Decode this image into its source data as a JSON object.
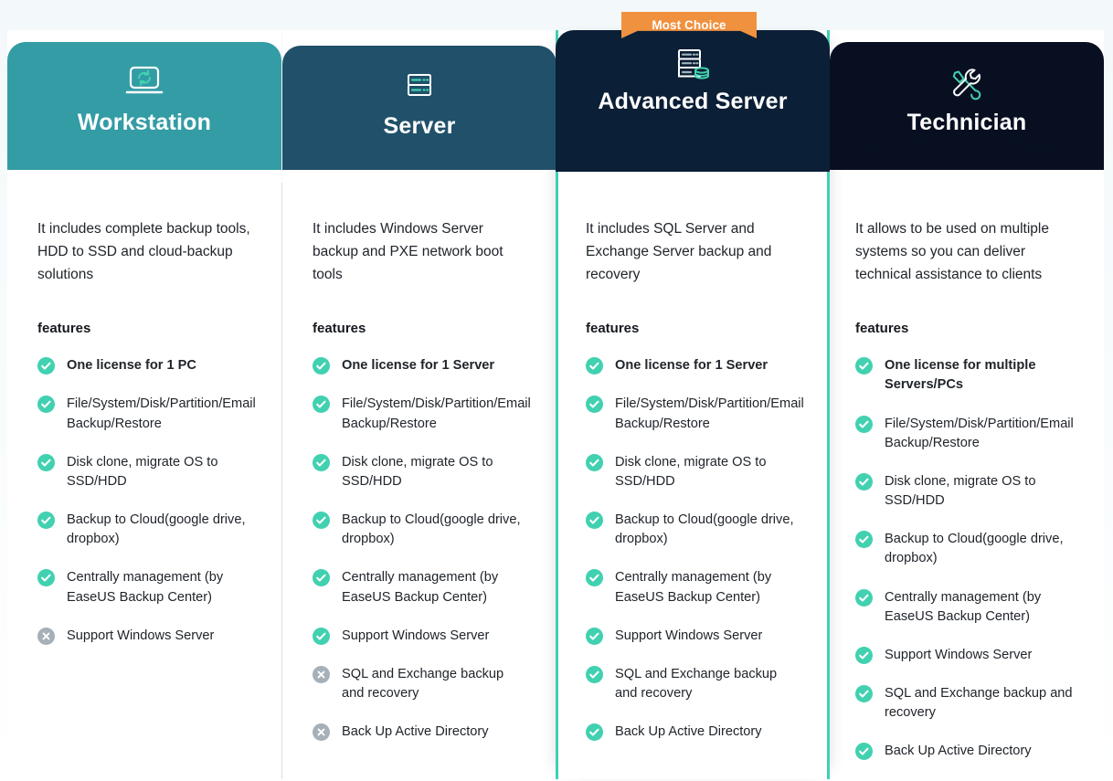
{
  "theme": {
    "accent_teal": "#41d1b0",
    "header_teal": "#339ca5",
    "header_blue": "#21506a",
    "header_navy": "#0b1f36",
    "header_dark": "#070f21",
    "badge_orange": "#f0913f",
    "disabled_gray": "#a6b0b8",
    "page_bg": "#f4f9fb"
  },
  "badge": {
    "label": "Most Choice"
  },
  "features_heading": "features",
  "plans": [
    {
      "id": "workstation",
      "title": "Workstation",
      "icon": "laptop-sync-icon",
      "description": "It includes complete backup tools, HDD to SSD and cloud-backup solutions",
      "features_label": "features",
      "features": [
        {
          "label": "One license for 1 PC",
          "status": "yes",
          "emphasis": true
        },
        {
          "label": "File/System/Disk/Partition/Email Backup/Restore",
          "status": "yes",
          "emphasis": false
        },
        {
          "label": "Disk clone, migrate OS to SSD/HDD",
          "status": "yes",
          "emphasis": false
        },
        {
          "label": "Backup to Cloud(google drive, dropbox)",
          "status": "yes",
          "emphasis": false
        },
        {
          "label": "Centrally management (by EaseUS Backup Center)",
          "status": "yes",
          "emphasis": false
        },
        {
          "label": "Support Windows Server",
          "status": "no",
          "emphasis": false
        }
      ]
    },
    {
      "id": "server",
      "title": "Server",
      "icon": "server-rack-icon",
      "description": "It includes Windows Server backup and PXE network boot tools",
      "features_label": "features",
      "features": [
        {
          "label": "One license for 1 Server",
          "status": "yes",
          "emphasis": true
        },
        {
          "label": "File/System/Disk/Partition/Email Backup/Restore",
          "status": "yes",
          "emphasis": false
        },
        {
          "label": "Disk clone, migrate OS to SSD/HDD",
          "status": "yes",
          "emphasis": false
        },
        {
          "label": "Backup to Cloud(google drive, dropbox)",
          "status": "yes",
          "emphasis": false
        },
        {
          "label": "Centrally management (by EaseUS Backup Center)",
          "status": "yes",
          "emphasis": false
        },
        {
          "label": "Support Windows Server",
          "status": "yes",
          "emphasis": false
        },
        {
          "label": "SQL and Exchange backup and recovery",
          "status": "no",
          "emphasis": false
        },
        {
          "label": "Back Up Active Directory",
          "status": "no",
          "emphasis": false
        }
      ]
    },
    {
      "id": "advanced-server",
      "title": "Advanced Server",
      "icon": "server-database-icon",
      "highlighted": true,
      "badge": "Most Choice",
      "description": "It includes SQL Server and Exchange Server backup and recovery",
      "features_label": "features",
      "features": [
        {
          "label": "One license for 1 Server",
          "status": "yes",
          "emphasis": true
        },
        {
          "label": "File/System/Disk/Partition/Email Backup/Restore",
          "status": "yes",
          "emphasis": false
        },
        {
          "label": "Disk clone, migrate OS to SSD/HDD",
          "status": "yes",
          "emphasis": false
        },
        {
          "label": "Backup to Cloud(google drive, dropbox)",
          "status": "yes",
          "emphasis": false
        },
        {
          "label": "Centrally management (by EaseUS Backup Center)",
          "status": "yes",
          "emphasis": false
        },
        {
          "label": "Support Windows Server",
          "status": "yes",
          "emphasis": false
        },
        {
          "label": "SQL and Exchange backup and recovery",
          "status": "yes",
          "emphasis": false
        },
        {
          "label": "Back Up Active Directory",
          "status": "yes",
          "emphasis": false
        }
      ]
    },
    {
      "id": "technician",
      "title": "Technician",
      "icon": "wrench-screwdriver-icon",
      "description": "It allows to be used on multiple systems so you can deliver technical assistance to clients",
      "features_label": "features",
      "features": [
        {
          "label": "One license for multiple Servers/PCs",
          "status": "yes",
          "emphasis": true
        },
        {
          "label": "File/System/Disk/Partition/Email Backup/Restore",
          "status": "yes",
          "emphasis": false
        },
        {
          "label": "Disk clone, migrate OS to SSD/HDD",
          "status": "yes",
          "emphasis": false
        },
        {
          "label": "Backup to Cloud(google drive, dropbox)",
          "status": "yes",
          "emphasis": false
        },
        {
          "label": "Centrally management (by EaseUS Backup Center)",
          "status": "yes",
          "emphasis": false
        },
        {
          "label": "Support Windows Server",
          "status": "yes",
          "emphasis": false
        },
        {
          "label": "SQL and Exchange backup and recovery",
          "status": "yes",
          "emphasis": false
        },
        {
          "label": "Back Up Active Directory",
          "status": "yes",
          "emphasis": false
        }
      ]
    }
  ]
}
